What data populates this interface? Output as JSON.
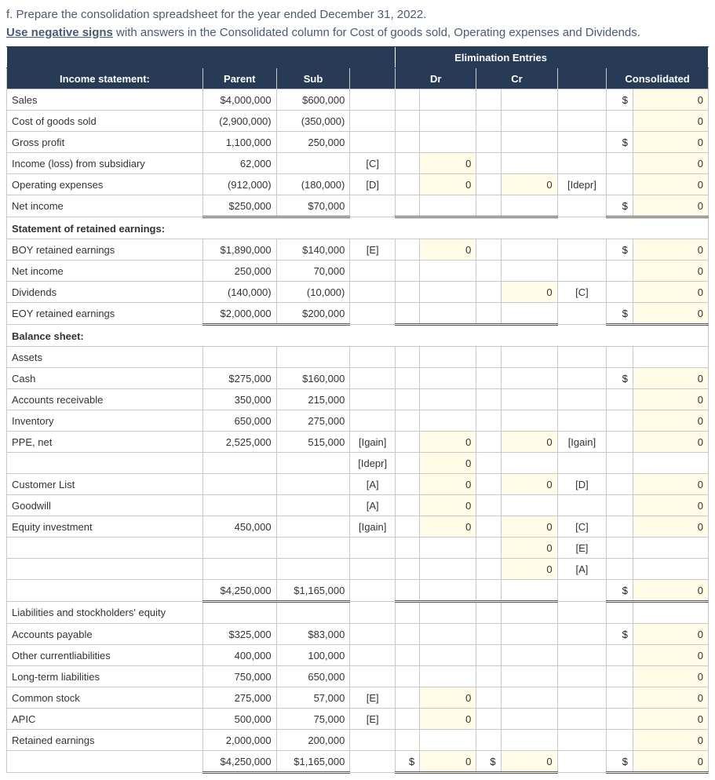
{
  "instructions": {
    "part": "f. Prepare the consolidation spreadsheet for the year ended December 31, 2022.",
    "emphasis": "Use negative signs",
    "rest": " with answers in the Consolidated column for Cost of goods sold, Operating expenses and Dividends."
  },
  "headers": {
    "elim": "Elimination Entries",
    "income": "Income statement:",
    "parent": "Parent",
    "sub": "Sub",
    "dr": "Dr",
    "cr": "Cr",
    "consolidated": "Consolidated"
  },
  "rows": {
    "sales": {
      "label": "Sales",
      "parent": "$4,000,000",
      "sub": "$600,000",
      "ref1": "",
      "dsym": "",
      "dr": "",
      "csym": "",
      "cr": "",
      "ref2": "",
      "consym": "$",
      "con": "0"
    },
    "cogs": {
      "label": "Cost of goods sold",
      "parent": "(2,900,000)",
      "sub": "(350,000)",
      "ref1": "",
      "dsym": "",
      "dr": "",
      "csym": "",
      "cr": "",
      "ref2": "",
      "consym": "",
      "con": "0"
    },
    "gross": {
      "label": "Gross profit",
      "parent": "1,100,000",
      "sub": "250,000",
      "ref1": "",
      "dsym": "",
      "dr": "",
      "csym": "",
      "cr": "",
      "ref2": "",
      "consym": "$",
      "con": "0"
    },
    "incsub": {
      "label": "Income (loss) from subsidiary",
      "parent": "62,000",
      "sub": "",
      "ref1": "[C]",
      "dsym": "",
      "dr": "0",
      "csym": "",
      "cr": "",
      "ref2": "",
      "consym": "",
      "con": "0"
    },
    "opexp": {
      "label": "Operating expenses",
      "parent": "(912,000)",
      "sub": "(180,000)",
      "ref1": "[D]",
      "dsym": "",
      "dr": "0",
      "csym": "",
      "cr": "0",
      "ref2": "[Idepr]",
      "consym": "",
      "con": "0"
    },
    "netinc": {
      "label": "Net income",
      "parent": "$250,000",
      "sub": "$70,000",
      "ref1": "",
      "dsym": "",
      "dr": "",
      "csym": "",
      "cr": "",
      "ref2": "",
      "consym": "$",
      "con": "0"
    },
    "sre": {
      "label": "Statement of retained earnings:"
    },
    "boy": {
      "label": "BOY retained earnings",
      "parent": "$1,890,000",
      "sub": "$140,000",
      "ref1": "[E]",
      "dsym": "",
      "dr": "0",
      "csym": "",
      "cr": "",
      "ref2": "",
      "consym": "$",
      "con": "0"
    },
    "netinc2": {
      "label": "Net income",
      "parent": "250,000",
      "sub": "70,000",
      "ref1": "",
      "dsym": "",
      "dr": "",
      "csym": "",
      "cr": "",
      "ref2": "",
      "consym": "",
      "con": "0"
    },
    "div": {
      "label": "Dividends",
      "parent": "(140,000)",
      "sub": "(10,000)",
      "ref1": "",
      "dsym": "",
      "dr": "",
      "csym": "",
      "cr": "0",
      "ref2": "[C]",
      "consym": "",
      "con": "0"
    },
    "eoy": {
      "label": "EOY retained earnings",
      "parent": "$2,000,000",
      "sub": "$200,000",
      "ref1": "",
      "dsym": "",
      "dr": "",
      "csym": "",
      "cr": "",
      "ref2": "",
      "consym": "$",
      "con": "0"
    },
    "bs": {
      "label": "Balance sheet:"
    },
    "assets": {
      "label": "Assets"
    },
    "cash": {
      "label": "Cash",
      "parent": "$275,000",
      "sub": "$160,000",
      "ref1": "",
      "dsym": "",
      "dr": "",
      "csym": "",
      "cr": "",
      "ref2": "",
      "consym": "$",
      "con": "0"
    },
    "ar": {
      "label": "Accounts receivable",
      "parent": "350,000",
      "sub": "215,000",
      "ref1": "",
      "dsym": "",
      "dr": "",
      "csym": "",
      "cr": "",
      "ref2": "",
      "consym": "",
      "con": "0"
    },
    "inv": {
      "label": "Inventory",
      "parent": "650,000",
      "sub": "275,000",
      "ref1": "",
      "dsym": "",
      "dr": "",
      "csym": "",
      "cr": "",
      "ref2": "",
      "consym": "",
      "con": "0"
    },
    "ppe": {
      "label": "PPE, net",
      "parent": "2,525,000",
      "sub": "515,000",
      "ref1": "[Igain]",
      "dsym": "",
      "dr": "0",
      "csym": "",
      "cr": "0",
      "ref2": "[Igain]",
      "consym": "",
      "con": "0"
    },
    "ppe2": {
      "label": "",
      "parent": "",
      "sub": "",
      "ref1": "[Idepr]",
      "dsym": "",
      "dr": "0",
      "csym": "",
      "cr": "",
      "ref2": "",
      "consym": "",
      "con": ""
    },
    "cust": {
      "label": "Customer List",
      "parent": "",
      "sub": "",
      "ref1": "[A]",
      "dsym": "",
      "dr": "0",
      "csym": "",
      "cr": "0",
      "ref2": "[D]",
      "consym": "",
      "con": "0"
    },
    "gw": {
      "label": "Goodwill",
      "parent": "",
      "sub": "",
      "ref1": "[A]",
      "dsym": "",
      "dr": "0",
      "csym": "",
      "cr": "",
      "ref2": "",
      "consym": "",
      "con": "0"
    },
    "eqinv": {
      "label": "Equity investment",
      "parent": "450,000",
      "sub": "",
      "ref1": "[Igain]",
      "dsym": "",
      "dr": "0",
      "csym": "",
      "cr": "0",
      "ref2": "[C]",
      "consym": "",
      "con": "0"
    },
    "eqinv2": {
      "label": "",
      "parent": "",
      "sub": "",
      "ref1": "",
      "dsym": "",
      "dr": "",
      "csym": "",
      "cr": "0",
      "ref2": "[E]",
      "consym": "",
      "con": ""
    },
    "eqinv3": {
      "label": "",
      "parent": "",
      "sub": "",
      "ref1": "",
      "dsym": "",
      "dr": "",
      "csym": "",
      "cr": "0",
      "ref2": "[A]",
      "consym": "",
      "con": ""
    },
    "tassets": {
      "label": "",
      "parent": "$4,250,000",
      "sub": "$1,165,000",
      "ref1": "",
      "dsym": "",
      "dr": "",
      "csym": "",
      "cr": "",
      "ref2": "",
      "consym": "$",
      "con": "0"
    },
    "lse": {
      "label": "Liabilities and stockholders' equity"
    },
    "ap": {
      "label": "Accounts payable",
      "parent": "$325,000",
      "sub": "$83,000",
      "ref1": "",
      "dsym": "",
      "dr": "",
      "csym": "",
      "cr": "",
      "ref2": "",
      "consym": "$",
      "con": "0"
    },
    "ocl": {
      "label": "Other currentliabilities",
      "parent": "400,000",
      "sub": "100,000",
      "ref1": "",
      "dsym": "",
      "dr": "",
      "csym": "",
      "cr": "",
      "ref2": "",
      "consym": "",
      "con": "0"
    },
    "ltl": {
      "label": "Long-term liabilities",
      "parent": "750,000",
      "sub": "650,000",
      "ref1": "",
      "dsym": "",
      "dr": "",
      "csym": "",
      "cr": "",
      "ref2": "",
      "consym": "",
      "con": "0"
    },
    "cs": {
      "label": "Common stock",
      "parent": "275,000",
      "sub": "57,000",
      "ref1": "[E]",
      "dsym": "",
      "dr": "0",
      "csym": "",
      "cr": "",
      "ref2": "",
      "consym": "",
      "con": "0"
    },
    "apic": {
      "label": "APIC",
      "parent": "500,000",
      "sub": "75,000",
      "ref1": "[E]",
      "dsym": "",
      "dr": "0",
      "csym": "",
      "cr": "",
      "ref2": "",
      "consym": "",
      "con": "0"
    },
    "re": {
      "label": "Retained earnings",
      "parent": "2,000,000",
      "sub": "200,000",
      "ref1": "",
      "dsym": "",
      "dr": "",
      "csym": "",
      "cr": "",
      "ref2": "",
      "consym": "",
      "con": "0"
    },
    "tlse": {
      "label": "",
      "parent": "$4,250,000",
      "sub": "$1,165,000",
      "ref1": "",
      "dsym": "$",
      "dr": "0",
      "csym": "$",
      "cr": "0",
      "ref2": "",
      "consym": "$",
      "con": "0"
    }
  }
}
